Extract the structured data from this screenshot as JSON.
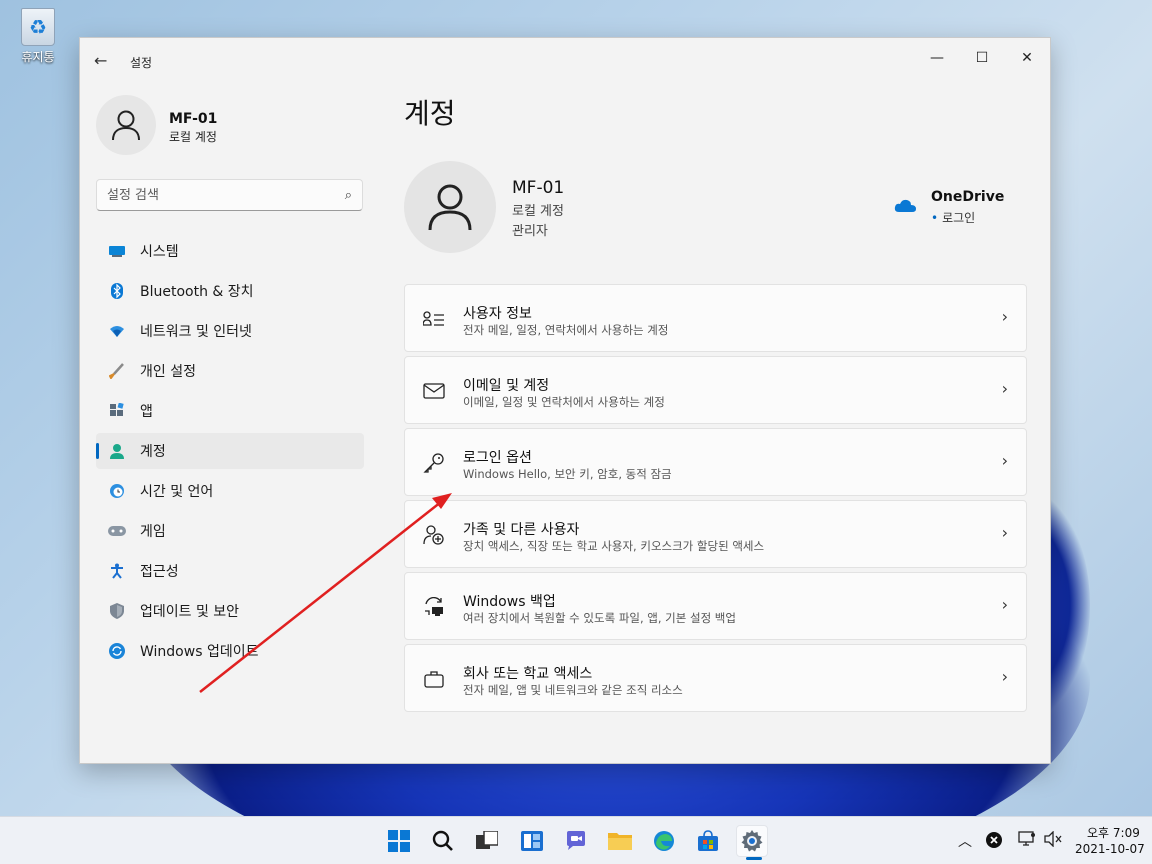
{
  "desktop": {
    "recycle_bin_label": "휴지통"
  },
  "window": {
    "app_title": "설정",
    "controls": {
      "minimize": "—",
      "maximize": "☐",
      "close": "✕"
    }
  },
  "sidebar": {
    "profile_name": "MF-01",
    "profile_type": "로컬 계정",
    "search_placeholder": "설정 검색",
    "items": [
      {
        "label": "시스템",
        "icon": "system-icon"
      },
      {
        "label": "Bluetooth & 장치",
        "icon": "bluetooth-icon"
      },
      {
        "label": "네트워크 및 인터넷",
        "icon": "wifi-icon"
      },
      {
        "label": "개인 설정",
        "icon": "brush-icon"
      },
      {
        "label": "앱",
        "icon": "apps-icon"
      },
      {
        "label": "계정",
        "icon": "account-icon",
        "active": true
      },
      {
        "label": "시간 및 언어",
        "icon": "globe-clock-icon"
      },
      {
        "label": "게임",
        "icon": "gamepad-icon"
      },
      {
        "label": "접근성",
        "icon": "accessibility-icon"
      },
      {
        "label": "업데이트 및 보안",
        "icon": "shield-icon"
      },
      {
        "label": "Windows 업데이트",
        "icon": "update-icon"
      }
    ]
  },
  "main": {
    "page_title": "계정",
    "user": {
      "name": "MF-01",
      "type": "로컬 계정",
      "role": "관리자"
    },
    "onedrive": {
      "name": "OneDrive",
      "status": "로그인"
    },
    "cards": [
      {
        "title": "사용자 정보",
        "subtitle": "전자 메일, 일정, 연락처에서 사용하는 계정"
      },
      {
        "title": "이메일 및 계정",
        "subtitle": "이메일, 일정 및 연락처에서 사용하는 계정"
      },
      {
        "title": "로그인 옵션",
        "subtitle": "Windows Hello, 보안 키, 암호, 동적 잠금"
      },
      {
        "title": "가족 및 다른 사용자",
        "subtitle": "장치 액세스, 직장 또는 학교 사용자, 키오스크가 할당된 액세스"
      },
      {
        "title": "Windows 백업",
        "subtitle": "여러 장치에서 복원할 수 있도록 파일, 앱, 기본 설정 백업"
      },
      {
        "title": "회사 또는 학교 액세스",
        "subtitle": "전자 메일, 앱 및 네트워크와 같은 조직 리소스"
      }
    ]
  },
  "taskbar": {
    "clock_time": "오후 7:09",
    "clock_date": "2021-10-07"
  },
  "colors": {
    "accent": "#0067c0",
    "annotation_arrow": "#e02020"
  }
}
